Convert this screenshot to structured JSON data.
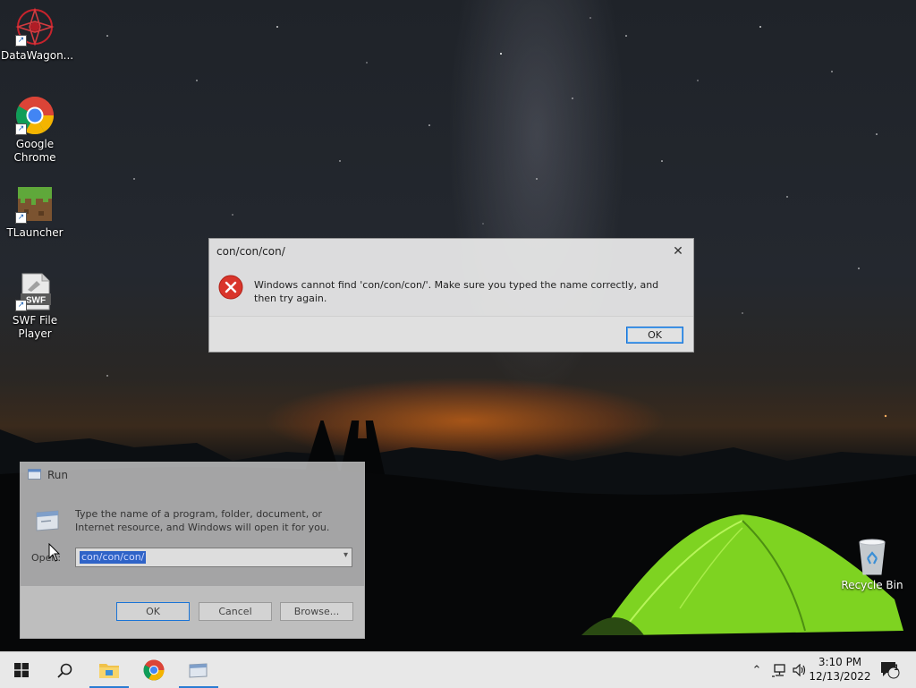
{
  "desktop": {
    "icons": [
      {
        "label": "DataWagon...",
        "icon": "datawagon-icon"
      },
      {
        "label": "Google Chrome",
        "icon": "chrome-icon"
      },
      {
        "label": "TLauncher",
        "icon": "minecraft-grass-block-icon"
      },
      {
        "label": "SWF File Player",
        "icon": "swf-file-icon"
      },
      {
        "label": "Recycle Bin",
        "icon": "recycle-bin-icon"
      }
    ]
  },
  "error_dialog": {
    "title": "con/con/con/",
    "message": "Windows cannot find 'con/con/con/'. Make sure you typed the name correctly, and then try again.",
    "ok_label": "OK",
    "icon": "error-icon"
  },
  "run_dialog": {
    "title": "Run",
    "description": "Type the name of a program, folder, document, or Internet resource, and Windows will open it for you.",
    "open_label": "Open:",
    "open_value": "con/con/con/",
    "ok_label": "OK",
    "cancel_label": "Cancel",
    "browse_label": "Browse..."
  },
  "taskbar": {
    "start": "windows-start-icon",
    "search": "search-icon",
    "apps": [
      "file-explorer-icon",
      "chrome-icon",
      "run-icon"
    ],
    "tray": [
      "chevron-up-icon",
      "network-icon",
      "volume-icon"
    ],
    "time": "3:10 PM",
    "date": "12/13/2022",
    "notification_count": "1"
  },
  "colors": {
    "accent": "#2b7cd3",
    "error_red": "#d9352b"
  }
}
